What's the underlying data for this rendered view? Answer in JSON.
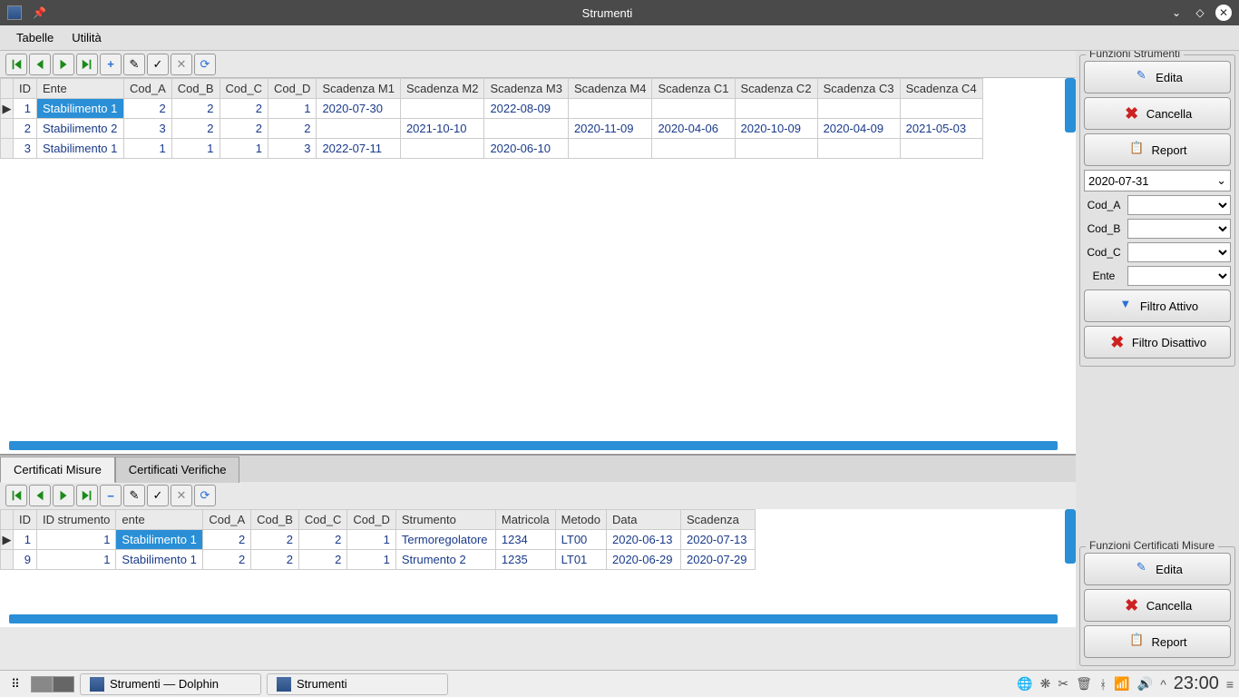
{
  "window": {
    "title": "Strumenti"
  },
  "menu": {
    "items": [
      "Tabelle",
      "Utilità"
    ]
  },
  "upper": {
    "cols": [
      "ID",
      "Ente",
      "Cod_A",
      "Cod_B",
      "Cod_C",
      "Cod_D",
      "Scadenza M1",
      "Scadenza M2",
      "Scadenza M3",
      "Scadenza M4",
      "Scadenza C1",
      "Scadenza C2",
      "Scadenza C3",
      "Scadenza C4"
    ],
    "rows": [
      {
        "id": "1",
        "ente": "Stabilimento 1",
        "a": "2",
        "b": "2",
        "c": "2",
        "d": "1",
        "m1": "2020-07-30",
        "m2": "",
        "m3": "2022-08-09",
        "m4": "",
        "c1": "",
        "c2": "",
        "c3": "",
        "c4": ""
      },
      {
        "id": "2",
        "ente": "Stabilimento 2",
        "a": "3",
        "b": "2",
        "c": "2",
        "d": "2",
        "m1": "",
        "m2": "2021-10-10",
        "m3": "",
        "m4": "2020-11-09",
        "c1": "2020-04-06",
        "c2": "2020-10-09",
        "c3": "2020-04-09",
        "c4": "2021-05-03"
      },
      {
        "id": "3",
        "ente": "Stabilimento 1",
        "a": "1",
        "b": "1",
        "c": "1",
        "d": "3",
        "m1": "2022-07-11",
        "m2": "",
        "m3": "2020-06-10",
        "m4": "",
        "c1": "",
        "c2": "",
        "c3": "",
        "c4": ""
      }
    ]
  },
  "tabs": {
    "items": [
      "Certificati Misure",
      "Certificati Verifiche"
    ],
    "active": 0
  },
  "lower": {
    "cols": [
      "ID",
      "ID strumento",
      "ente",
      "Cod_A",
      "Cod_B",
      "Cod_C",
      "Cod_D",
      "Strumento",
      "Matricola",
      "Metodo",
      "Data",
      "Scadenza"
    ],
    "rows": [
      {
        "id": "1",
        "ids": "1",
        "ente": "Stabilimento 1",
        "a": "2",
        "b": "2",
        "c": "2",
        "d": "1",
        "str": "Termoregolatore",
        "mat": "1234",
        "met": "LT00",
        "data": "2020-06-13",
        "scad": "2020-07-13"
      },
      {
        "id": "9",
        "ids": "1",
        "ente": "Stabilimento 1",
        "a": "2",
        "b": "2",
        "c": "2",
        "d": "1",
        "str": "Strumento 2",
        "mat": "1235",
        "met": "LT01",
        "data": "2020-06-29",
        "scad": "2020-07-29"
      }
    ]
  },
  "sidepanel": {
    "upper_title": "Funzioni Strumenti",
    "lower_title": "Funzioni Certificati Misure",
    "edita": "Edita",
    "cancella": "Cancella",
    "report": "Report",
    "date": "2020-07-31",
    "filters": {
      "cod_a": "Cod_A",
      "cod_b": "Cod_B",
      "cod_c": "Cod_C",
      "ente": "Ente"
    },
    "filtro_attivo": "Filtro Attivo",
    "filtro_disattivo": "Filtro Disattivo"
  },
  "taskbar": {
    "task1": "Strumenti — Dolphin",
    "task2": "Strumenti",
    "clock": "23:00"
  }
}
